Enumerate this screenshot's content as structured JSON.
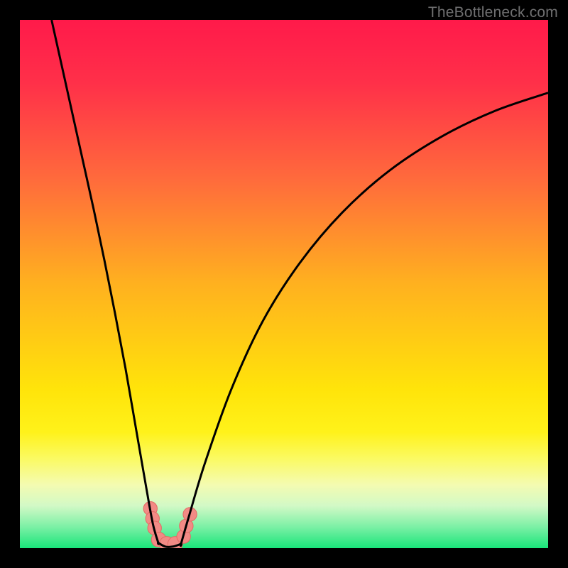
{
  "watermark": "TheBottleneck.com",
  "colors": {
    "frame": "#000000",
    "gradient_stops": [
      {
        "offset": 0.0,
        "color": "#ff1a4a"
      },
      {
        "offset": 0.12,
        "color": "#ff3049"
      },
      {
        "offset": 0.3,
        "color": "#ff6a3c"
      },
      {
        "offset": 0.5,
        "color": "#ffb11f"
      },
      {
        "offset": 0.7,
        "color": "#ffe40a"
      },
      {
        "offset": 0.78,
        "color": "#fff21a"
      },
      {
        "offset": 0.83,
        "color": "#fbfa62"
      },
      {
        "offset": 0.88,
        "color": "#f4fbb1"
      },
      {
        "offset": 0.92,
        "color": "#d2f9c6"
      },
      {
        "offset": 0.96,
        "color": "#7bf0a5"
      },
      {
        "offset": 1.0,
        "color": "#19e57a"
      }
    ],
    "curve": "#000000",
    "marker_fill": "#f28a85",
    "marker_stroke": "#e46a63"
  },
  "chart_data": {
    "type": "line",
    "title": "",
    "xlabel": "",
    "ylabel": "",
    "x_range": [
      0,
      1
    ],
    "y_range": [
      0,
      1
    ],
    "note": "Axes unlabeled in source; x/y normalized 0–1. y≈1 is red (high bottleneck), y≈0 is green (balanced). Curve dips to ~0 near x≈0.27.",
    "series": [
      {
        "name": "bottleneck-curve-left",
        "x": [
          0.06,
          0.08,
          0.1,
          0.12,
          0.14,
          0.16,
          0.18,
          0.2,
          0.22,
          0.24,
          0.252,
          0.262
        ],
        "y": [
          1.0,
          0.91,
          0.82,
          0.73,
          0.64,
          0.545,
          0.445,
          0.34,
          0.225,
          0.11,
          0.045,
          0.01
        ]
      },
      {
        "name": "bottleneck-curve-floor",
        "x": [
          0.262,
          0.275,
          0.29,
          0.305
        ],
        "y": [
          0.01,
          0.003,
          0.003,
          0.008
        ]
      },
      {
        "name": "bottleneck-curve-right",
        "x": [
          0.305,
          0.32,
          0.35,
          0.4,
          0.46,
          0.53,
          0.61,
          0.7,
          0.8,
          0.9,
          1.0
        ],
        "y": [
          0.008,
          0.06,
          0.16,
          0.3,
          0.43,
          0.54,
          0.635,
          0.715,
          0.78,
          0.828,
          0.862
        ]
      }
    ],
    "markers": [
      {
        "x": 0.247,
        "y": 0.075,
        "r": 0.013
      },
      {
        "x": 0.251,
        "y": 0.056,
        "r": 0.013
      },
      {
        "x": 0.255,
        "y": 0.038,
        "r": 0.013
      },
      {
        "x": 0.263,
        "y": 0.016,
        "r": 0.014
      },
      {
        "x": 0.278,
        "y": 0.008,
        "r": 0.014
      },
      {
        "x": 0.294,
        "y": 0.008,
        "r": 0.014
      },
      {
        "x": 0.31,
        "y": 0.022,
        "r": 0.013
      },
      {
        "x": 0.315,
        "y": 0.042,
        "r": 0.013
      },
      {
        "x": 0.322,
        "y": 0.064,
        "r": 0.013
      }
    ]
  }
}
